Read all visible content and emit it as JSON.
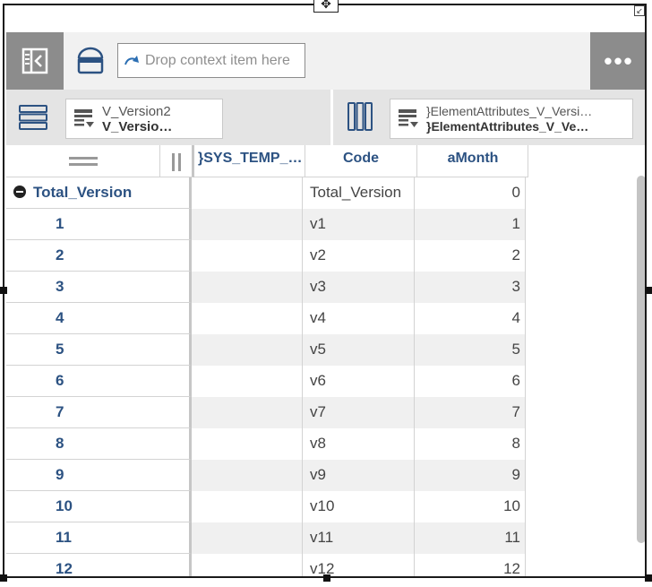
{
  "toolbar": {
    "drop_placeholder": "Drop context item here",
    "more_label": "•••"
  },
  "dimensions": {
    "rows": {
      "line1": "V_Version2",
      "line2": "V_Versio…"
    },
    "columns": {
      "line1": "}ElementAttributes_V_Versi…",
      "line2": "}ElementAttributes_V_Ve…"
    }
  },
  "grid": {
    "headers": {
      "sys_temp": "}SYS_TEMP_…",
      "code": "Code",
      "amonth": "aMonth"
    },
    "rows": [
      {
        "label": "Total_Version",
        "code": "Total_Version",
        "amonth": "0"
      },
      {
        "label": "1",
        "code": "v1",
        "amonth": "1"
      },
      {
        "label": "2",
        "code": "v2",
        "amonth": "2"
      },
      {
        "label": "3",
        "code": "v3",
        "amonth": "3"
      },
      {
        "label": "4",
        "code": "v4",
        "amonth": "4"
      },
      {
        "label": "5",
        "code": "v5",
        "amonth": "5"
      },
      {
        "label": "6",
        "code": "v6",
        "amonth": "6"
      },
      {
        "label": "7",
        "code": "v7",
        "amonth": "7"
      },
      {
        "label": "8",
        "code": "v8",
        "amonth": "8"
      },
      {
        "label": "9",
        "code": "v9",
        "amonth": "9"
      },
      {
        "label": "10",
        "code": "v10",
        "amonth": "10"
      },
      {
        "label": "11",
        "code": "v11",
        "amonth": "11"
      },
      {
        "label": "12",
        "code": "v12",
        "amonth": "12"
      }
    ]
  },
  "colors": {
    "accent_text": "#2c5282",
    "toolbar_button": "#8c8c8c"
  },
  "icons": [
    "move-icon",
    "resize-corner-icon",
    "collapse-panel-icon",
    "context-bar-icon",
    "redo-arrow-icon",
    "more-icon",
    "rows-dimension-icon",
    "subset-icon",
    "columns-dimension-icon",
    "menu-lines-icon",
    "pause-icon",
    "collapse-minus-icon"
  ]
}
